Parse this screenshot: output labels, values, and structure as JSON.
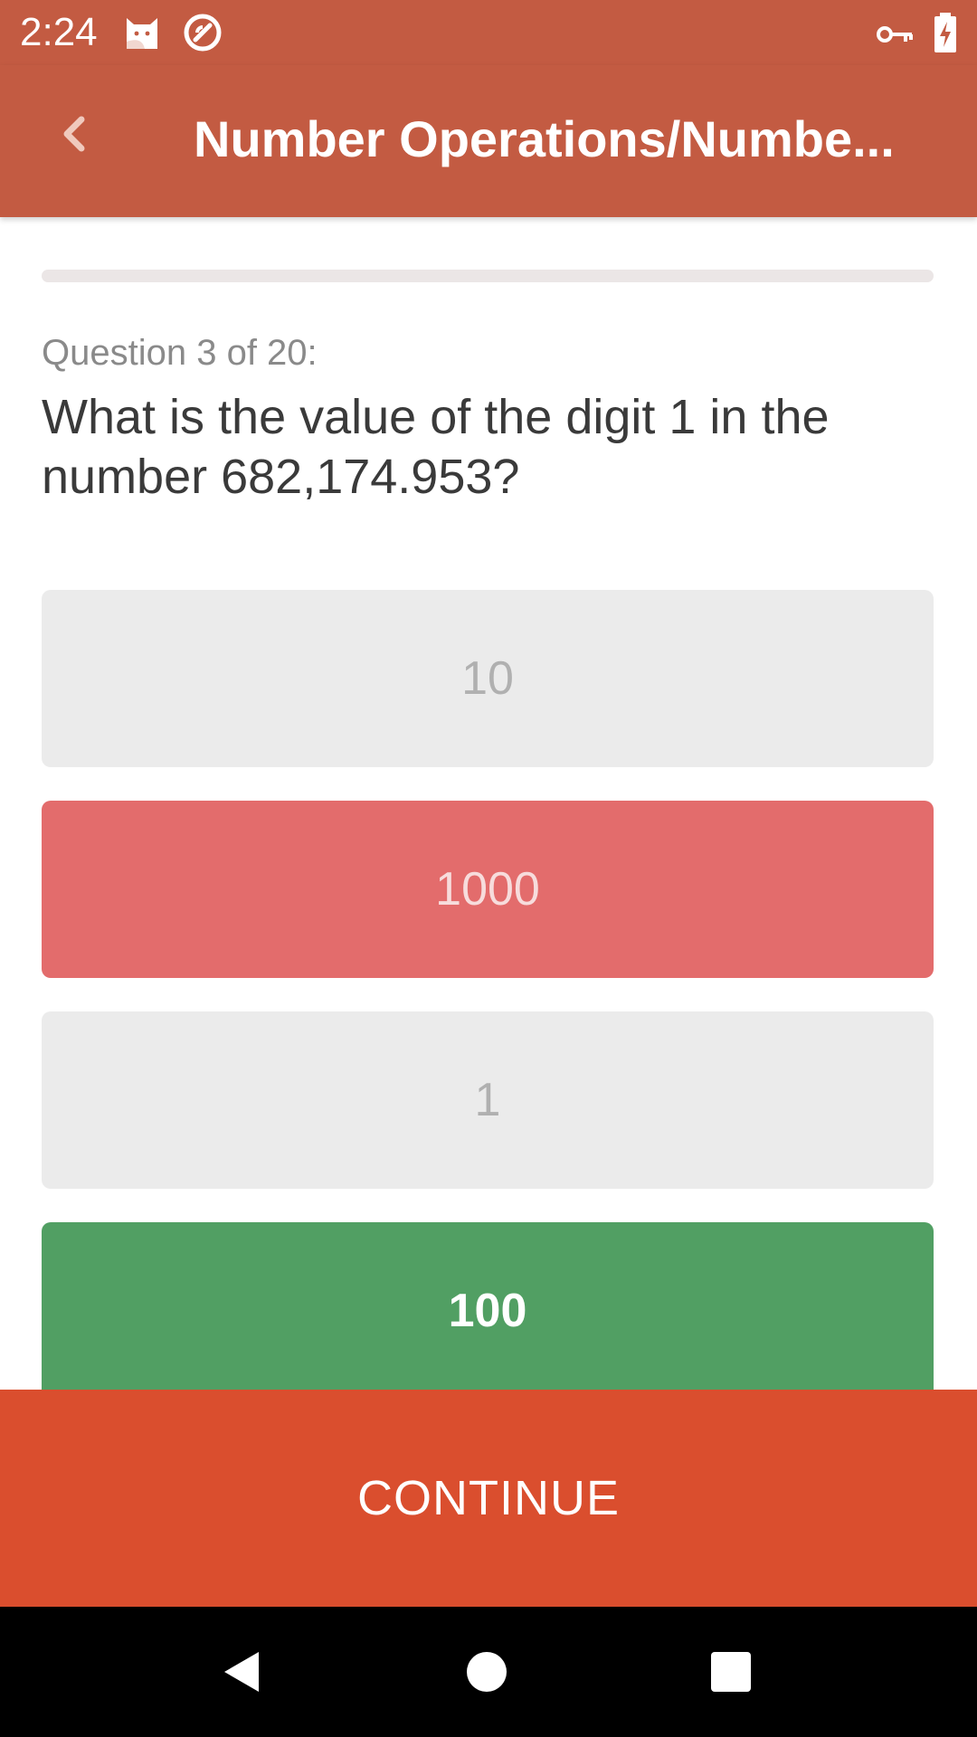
{
  "status_bar": {
    "time": "2:24",
    "left_icons": [
      "cat-notification-icon",
      "do-not-disturb-icon"
    ],
    "right_icons": [
      "vpn-key-icon",
      "battery-charging-icon"
    ]
  },
  "app_bar": {
    "title": "Number Operations/Numbe...",
    "back_icon": "chevron-left-icon",
    "color": "#c35b42"
  },
  "quiz": {
    "progress": 0,
    "question_label": "Question 3 of 20:",
    "question_text": "What is the value of the digit 1 in the number 682,174.953?",
    "answers": [
      {
        "label": "10",
        "state": "neutral"
      },
      {
        "label": "1000",
        "state": "wrong"
      },
      {
        "label": "1",
        "state": "neutral"
      },
      {
        "label": "100",
        "state": "correct"
      }
    ]
  },
  "continue_button": {
    "label": "CONTINUE",
    "color": "#da4e2e"
  },
  "colors": {
    "neutral": "#ebebeb",
    "wrong": "#e36c6c",
    "correct": "#519f63"
  },
  "nav_bar": {
    "icons": [
      "back-triangle-icon",
      "home-circle-icon",
      "recents-square-icon"
    ]
  }
}
